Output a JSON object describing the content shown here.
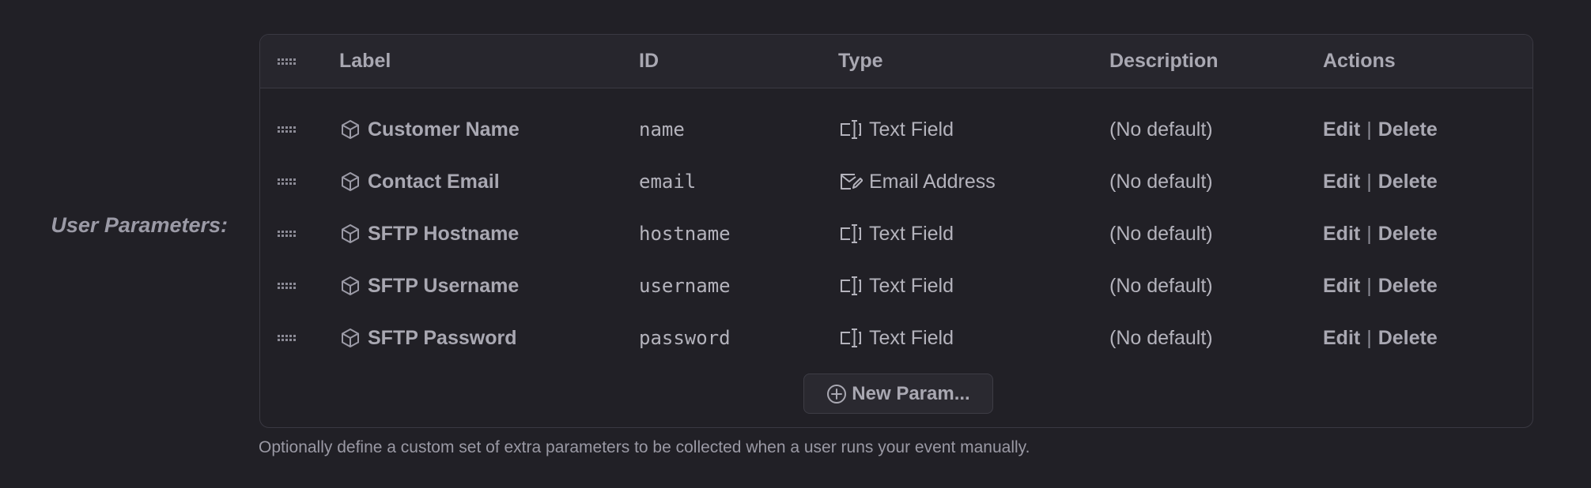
{
  "field": {
    "label": "User Parameters:",
    "help": "Optionally define a custom set of extra parameters to be collected when a user runs your event manually."
  },
  "table": {
    "columns": {
      "label": "Label",
      "id": "ID",
      "type": "Type",
      "description": "Description",
      "actions": "Actions"
    },
    "rows": [
      {
        "label": "Customer Name",
        "id": "name",
        "type": "Text Field",
        "type_icon": "text-field-icon",
        "description": "(No default)",
        "edit": "Edit",
        "delete": "Delete"
      },
      {
        "label": "Contact Email",
        "id": "email",
        "type": "Email Address",
        "type_icon": "email-icon",
        "description": "(No default)",
        "edit": "Edit",
        "delete": "Delete"
      },
      {
        "label": "SFTP Hostname",
        "id": "hostname",
        "type": "Text Field",
        "type_icon": "text-field-icon",
        "description": "(No default)",
        "edit": "Edit",
        "delete": "Delete"
      },
      {
        "label": "SFTP Username",
        "id": "username",
        "type": "Text Field",
        "type_icon": "text-field-icon",
        "description": "(No default)",
        "edit": "Edit",
        "delete": "Delete"
      },
      {
        "label": "SFTP Password",
        "id": "password",
        "type": "Text Field",
        "type_icon": "text-field-icon",
        "description": "(No default)",
        "edit": "Edit",
        "delete": "Delete"
      }
    ],
    "action_separator": "|",
    "new_button": "New Param..."
  },
  "colors": {
    "background": "#212026",
    "header_bg": "#27262d",
    "border": "#3a3942",
    "text": "#a9a8b2"
  }
}
